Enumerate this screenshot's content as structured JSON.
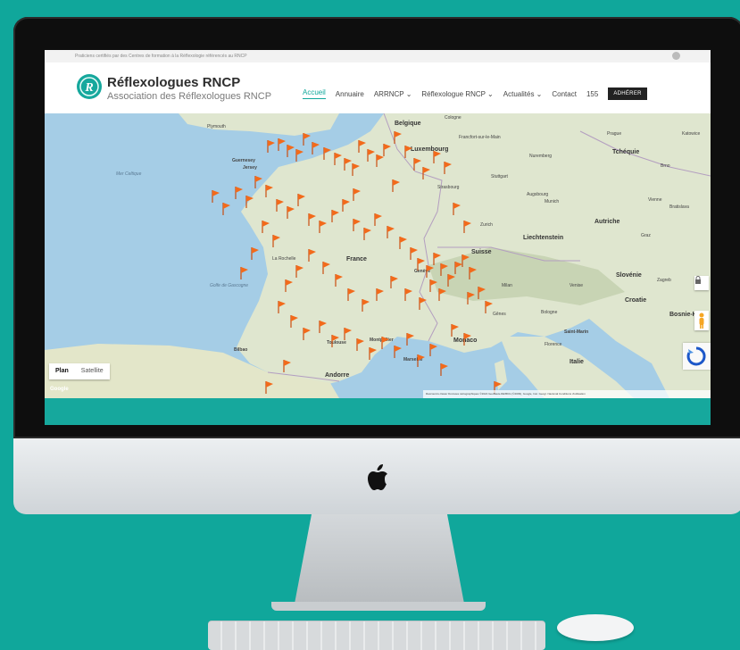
{
  "topbar": {
    "text": "Praticiens certifiés par des Centres de formation à la Réflexologie référencés au RNCP"
  },
  "brand": {
    "name": "Réflexologues RNCP",
    "subtitle": "Association des Réflexologues RNCP",
    "logo_letter": "R"
  },
  "nav": {
    "items": [
      {
        "label": "Accueil",
        "active": true
      },
      {
        "label": "Annuaire"
      },
      {
        "label": "ARRNCP ⌄"
      },
      {
        "label": "Réflexologue RNCP ⌄"
      },
      {
        "label": "Actualités ⌄"
      },
      {
        "label": "Contact"
      }
    ],
    "phone": "155",
    "cta": "ADHÉRER"
  },
  "map": {
    "type_buttons": [
      "Plan",
      "Satellite"
    ],
    "google_logo": "Google",
    "attribution": "Raccourcis clavier   Données cartographiques ©2022 GeoBasis-DE/BKG (©2009), Google, Inst. Geogr. Nacional   Conditions d'utilisation",
    "labels": {
      "belgique": "Belgique",
      "luxembourg": "Luxembourg",
      "cologne": "Cologne",
      "frankfurt": "Francfort-sur-le-Main",
      "nuremberg": "Nuremberg",
      "prague": "Prague",
      "tcheque": "Tchéquie",
      "katowice": "Katowice",
      "brno": "Brno",
      "stuttgart": "Stuttgart",
      "strasbourg": "Strasbourg",
      "augsburg": "Augsbourg",
      "munich": "Munich",
      "vienne": "Vienne",
      "bratislava": "Bratislava",
      "zurich": "Zurich",
      "liechtenstein": "Liechtenstein",
      "autriche": "Autriche",
      "graz": "Graz",
      "suisse": "Suisse",
      "france": "France",
      "slovenie": "Slovénie",
      "zagreb": "Zagreb",
      "croatie": "Croatie",
      "bosnie": "Bosnie-He",
      "milan": "Milan",
      "venise": "Venise",
      "genes": "Gênes",
      "bologne": "Bologne",
      "saint_marin": "Saint-Marin",
      "florence": "Florence",
      "italie": "Italie",
      "monaco": "Monaco",
      "marseille": "Marseille",
      "montpellier": "Montpellier",
      "toulouse": "Toulouse",
      "andorre": "Andorre",
      "bilbao": "Bilbao",
      "guernesey": "Guernesey",
      "jersey": "Jersey",
      "plymouth": "Plymouth",
      "mer_celtique": "Mer Celtique",
      "golfe_gascogne": "Golfe de Gascogne",
      "la_rochelle": "La Rochelle",
      "geneve": "Genève"
    }
  },
  "colors": {
    "background": "#10a79b",
    "accent": "#10a79b",
    "pin": "#f26a1b",
    "land": "#dfe6cf",
    "water": "#a5cde6"
  }
}
